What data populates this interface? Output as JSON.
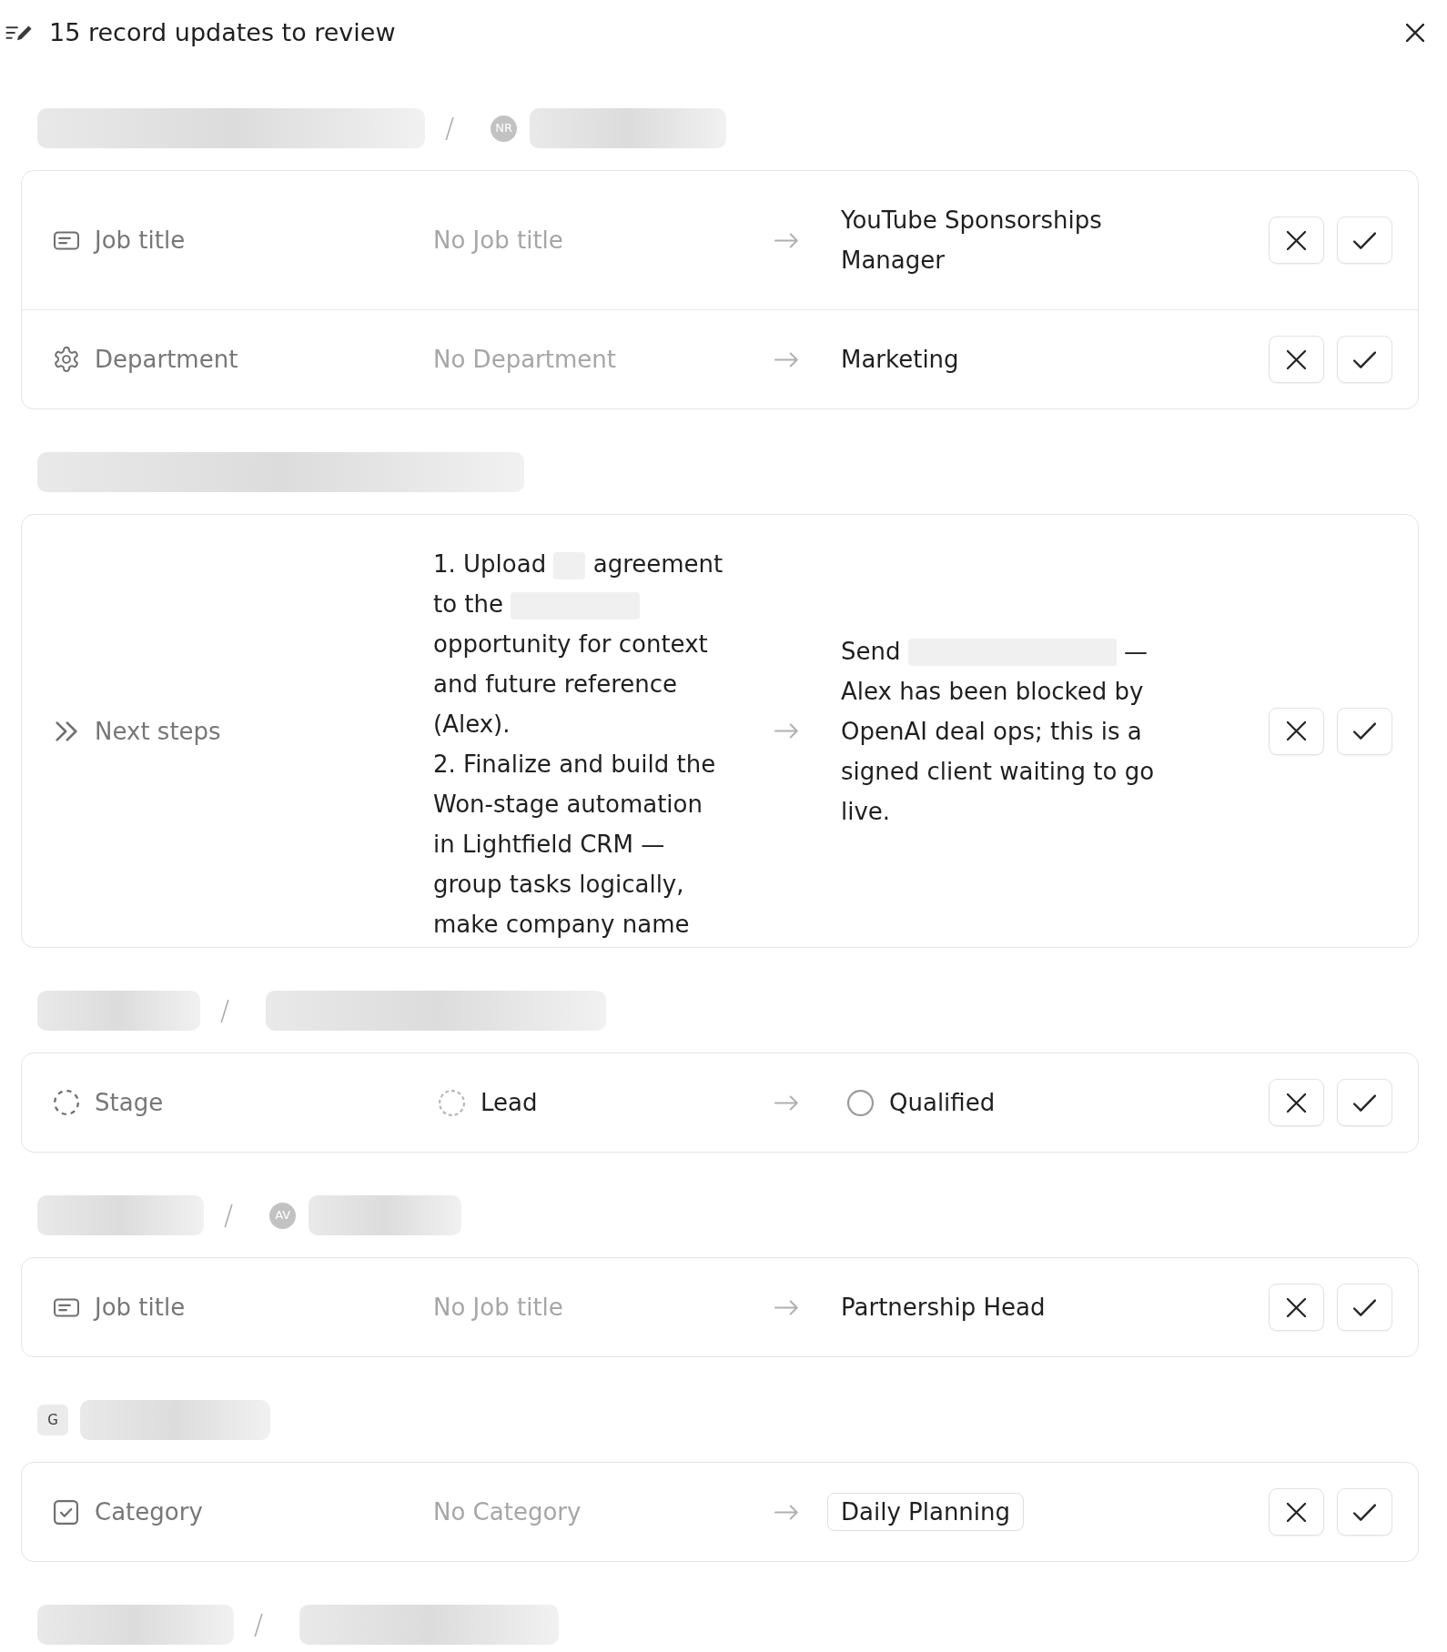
{
  "header": {
    "title": "15 record updates to review"
  },
  "groups": [
    {
      "path": [
        {
          "kind": "redacted"
        },
        {
          "kind": "separator",
          "text": "/"
        },
        {
          "kind": "avatar",
          "text": "NR"
        },
        {
          "kind": "redacted"
        }
      ],
      "changes": [
        {
          "field": {
            "kind": "text",
            "label": "Job title"
          },
          "old": {
            "kind": "empty",
            "text": "No Job title"
          },
          "new": {
            "kind": "text",
            "text": "YouTube Sponsorships Manager"
          }
        },
        {
          "field": {
            "kind": "choice",
            "label": "Department"
          },
          "old": {
            "kind": "empty",
            "text": "No Department"
          },
          "new": {
            "kind": "text",
            "text": "Marketing"
          }
        }
      ]
    },
    {
      "path": [
        {
          "kind": "redacted"
        }
      ],
      "changes": [
        {
          "field": {
            "kind": "notes",
            "label": "Next steps"
          },
          "old": {
            "kind": "text",
            "parts": [
              {
                "kind": "text",
                "text": "1. Upload"
              },
              {
                "kind": "redacted"
              },
              {
                "kind": "text",
                "text": "agreement to the"
              },
              {
                "kind": "redacted"
              },
              {
                "kind": "text",
                "text": "opportunity for context and future reference (Alex).\n2. Finalize and build the Won-stage automation in Lightfield CRM — group tasks logically, make company name"
              }
            ]
          },
          "new": {
            "kind": "text",
            "parts": [
              {
                "kind": "text",
                "text": "Send"
              },
              {
                "kind": "redacted"
              },
              {
                "kind": "text",
                "text": "— Alex has been blocked by OpenAI deal ops; this is a signed client waiting to go live."
              }
            ]
          }
        }
      ]
    },
    {
      "path": [
        {
          "kind": "redacted"
        },
        {
          "kind": "separator",
          "text": "/"
        },
        {
          "kind": "redacted"
        }
      ],
      "changes": [
        {
          "field": {
            "kind": "status",
            "label": "Stage"
          },
          "old": {
            "kind": "stage",
            "text": "Lead",
            "dashed": true
          },
          "new": {
            "kind": "stage",
            "text": "Qualified",
            "dashed": false
          }
        }
      ]
    },
    {
      "path": [
        {
          "kind": "redacted"
        },
        {
          "kind": "separator",
          "text": "/"
        },
        {
          "kind": "avatar",
          "text": "AV"
        },
        {
          "kind": "redacted"
        }
      ],
      "changes": [
        {
          "field": {
            "kind": "text",
            "label": "Job title"
          },
          "old": {
            "kind": "empty",
            "text": "No Job title"
          },
          "new": {
            "kind": "text",
            "text": "Partnership Head"
          }
        }
      ]
    },
    {
      "path": [
        {
          "kind": "logo",
          "text": "G"
        },
        {
          "kind": "redacted"
        }
      ],
      "changes": [
        {
          "field": {
            "kind": "checkbox",
            "label": "Category"
          },
          "old": {
            "kind": "empty",
            "text": "No Category"
          },
          "new": {
            "kind": "tag",
            "text": "Daily Planning"
          }
        }
      ]
    },
    {
      "path": [
        {
          "kind": "redacted"
        },
        {
          "kind": "separator",
          "text": "/"
        },
        {
          "kind": "redacted"
        }
      ]
    }
  ]
}
